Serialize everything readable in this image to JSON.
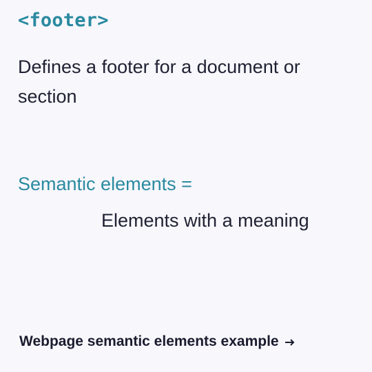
{
  "tag": {
    "heading": "<footer>"
  },
  "description": {
    "text": "Defines a footer for a document or section"
  },
  "semantic": {
    "title": "Semantic elements =",
    "definition": "Elements with a meaning"
  },
  "footer_link": {
    "label": "Webpage semantic elements example",
    "icon": "arrow-right-icon"
  },
  "colors": {
    "accent": "#2a8aa0",
    "text": "#1f2133",
    "background": "#f8f7fc"
  }
}
